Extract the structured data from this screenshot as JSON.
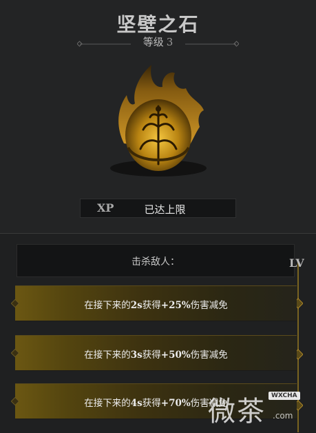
{
  "item": {
    "name": "坚壁之石",
    "level_label": "等级",
    "level_value": "3",
    "icon": "golden-flame-stone-icon"
  },
  "xp": {
    "tag": "XP",
    "status": "已达上限"
  },
  "effects": {
    "trigger": "击杀敌人：",
    "lv_label": "LV",
    "tiers": [
      {
        "prefix": "在接下来的",
        "duration": "2s",
        "mid": "获得",
        "amount": "+25%",
        "suffix": "伤害减免"
      },
      {
        "prefix": "在接下来的",
        "duration": "3s",
        "mid": "获得",
        "amount": "+50%",
        "suffix": "伤害减免"
      },
      {
        "prefix": "在接下来的",
        "duration": "4s",
        "mid": "获得",
        "amount": "+70%",
        "suffix": "伤害减免"
      }
    ]
  },
  "watermark": {
    "chars": "微茶",
    "badge": "WXCHA",
    "url": ".com"
  },
  "colors": {
    "background": "#232425",
    "gold": "#c79a2a",
    "tier_gradient_start": "#6b5712",
    "text": "#ececec"
  }
}
